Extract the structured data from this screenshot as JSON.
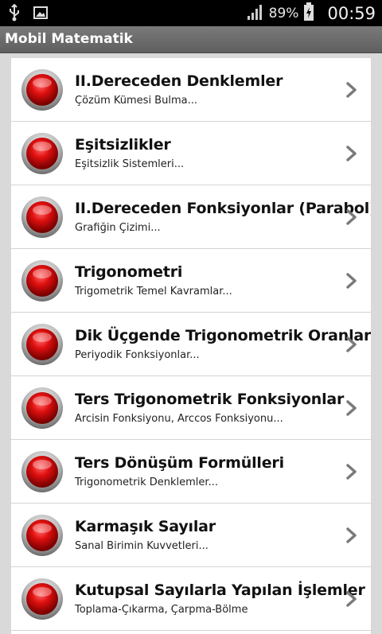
{
  "status_bar": {
    "left_icons": [
      "usb-icon",
      "image-icon"
    ],
    "battery_text": "89%",
    "time": "00:59"
  },
  "app": {
    "title": "Mobil Matematik"
  },
  "items": [
    {
      "title": "II.Dereceden Denklemler",
      "subtitle": "Çözüm Kümesi Bulma..."
    },
    {
      "title": "Eşitsizlikler",
      "subtitle": "Eşitsizlik Sistemleri..."
    },
    {
      "title": "II.Dereceden Fonksiyonlar (Parabol)",
      "subtitle": "Grafiğin Çizimi..."
    },
    {
      "title": "Trigonometri",
      "subtitle": "Trigometrik Temel Kavramlar..."
    },
    {
      "title": "Dik Üçgende Trigonometrik Oranlar",
      "subtitle": "Periyodik Fonksiyonlar..."
    },
    {
      "title": "Ters Trigonometrik Fonksiyonlar",
      "subtitle": "Arcisin Fonksiyonu, Arccos Fonksiyonu..."
    },
    {
      "title": "Ters Dönüşüm Formülleri",
      "subtitle": "Trigonometrik Denklemler..."
    },
    {
      "title": "Karmaşık Sayılar",
      "subtitle": "Sanal Birimin Kuvvetleri..."
    },
    {
      "title": "Kutupsal Sayılarla Yapılan İşlemler",
      "subtitle": "Toplama-Çıkarma, Çarpma-Bölme"
    }
  ],
  "colors": {
    "bullet": "#e01010",
    "chevron": "#7a7a7a",
    "titlebar": "#6b6b6b"
  }
}
